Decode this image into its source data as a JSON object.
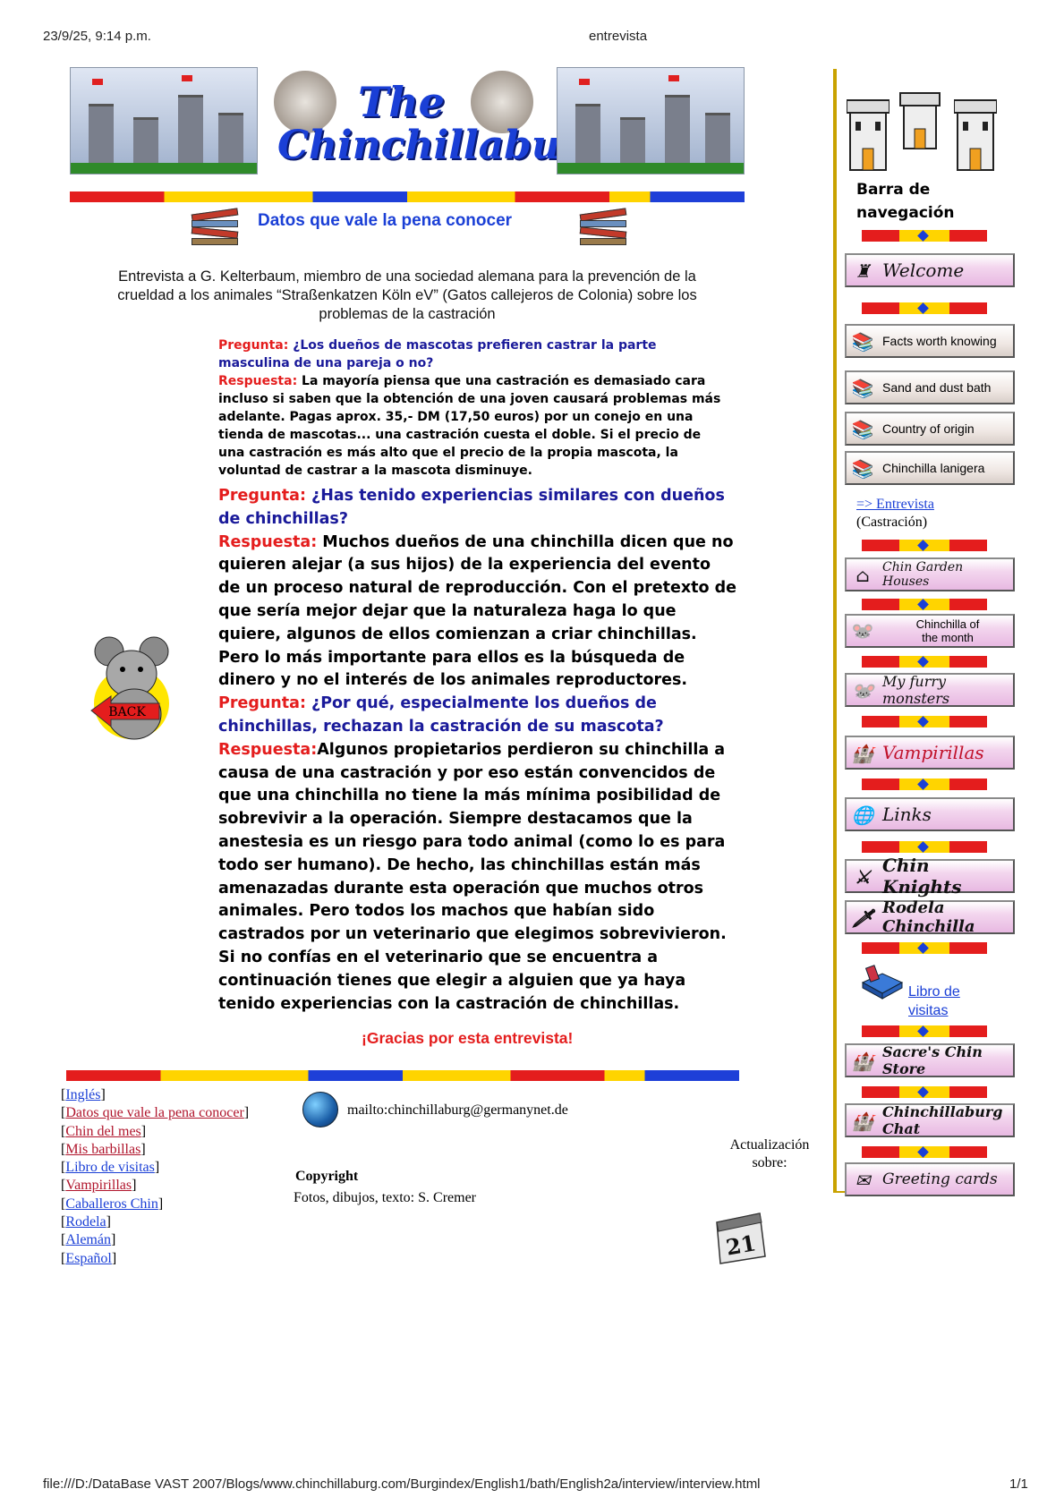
{
  "print_header": {
    "datetime": "23/9/25, 9:14 p.m.",
    "title": "entrevista"
  },
  "print_footer": {
    "url": "file:///D:/DataBase VAST 2007/Blogs/www.chinchillaburg.com/Burgindex/English1/bath/English2a/interview/interview.html",
    "page": "1/1"
  },
  "logo": {
    "the": "The",
    "name": "Chinchillaburg"
  },
  "section_title": "Datos que vale la pena conocer",
  "intro": "Entrevista a G. Kelterbaum, miembro de una sociedad alemana para la prevención de la crueldad a los animales “Straßenkatzen Köln eV” (Gatos callejeros de Colonia) sobre los problemas de la castración",
  "qa": [
    {
      "q_label": "Pregunta:",
      "q": " ¿Los dueños de mascotas prefieren castrar la parte masculina de una pareja o no?",
      "a_label": "Respuesta:",
      "a": " La mayoría piensa que una castración es demasiado cara incluso si saben que la obtención de una joven causará problemas más adelante. Pagas aprox. 35,- DM (17,50 euros) por un conejo en una tienda de mascotas... una castración cuesta el doble. Si el precio de una castración es más alto que el precio de la propia mascota, la voluntad de castrar a la mascota disminuye."
    },
    {
      "q_label": "Pregunta:",
      "q": " ¿Has tenido experiencias similares con dueños de chinchillas?",
      "a_label": "Respuesta:",
      "a": " Muchos dueños de una chinchilla dicen que no quieren alejar (a sus hijos) de la experiencia del evento de un proceso natural de reproducción. Con el pretexto de que sería mejor dejar que la naturaleza haga lo que quiere, algunos de ellos comienzan a criar chinchillas. Pero lo más importante para ellos es la búsqueda de dinero y no el interés de los animales reproductores."
    },
    {
      "q_label": "Pregunta:",
      "q": " ¿Por qué, especialmente los dueños de chinchillas, rechazan la castración de su mascota?",
      "a_label": "Respuesta:",
      "a": "Algunos propietarios perdieron su chinchilla a causa de una castración y por eso están convencidos de que una chinchilla no tiene la más mínima posibilidad de sobrevivir a la operación. Siempre destacamos que la anestesia es un riesgo para todo animal (como lo es para todo ser humano). De hecho, las chinchillas están más amenazadas durante esta operación que muchos otros animales. Pero todos los machos que habían sido castrados por un veterinario que elegimos sobrevivieron. Si no confías en el veterinario que se encuentra a continuación tienes que elegir a alguien que ya haya tenido experiencias con la castración de chinchillas."
    }
  ],
  "thanks": "¡Gracias por esta entrevista!",
  "back_label": "BACK",
  "footer_links": [
    {
      "label": "Inglés",
      "color": "#1a3fd6"
    },
    {
      "label": "Datos que vale la pena conocer",
      "color": "#b0152c"
    },
    {
      "label": "Chin del mes",
      "color": "#b0152c"
    },
    {
      "label": "Mis barbillas",
      "color": "#b0152c"
    },
    {
      "label": "Libro de visitas",
      "color": "#1a3fd6"
    },
    {
      "label": "Vampirillas",
      "color": "#b0152c"
    },
    {
      "label": "Caballeros Chin",
      "color": "#1a3fd6"
    },
    {
      "label": "Rodela",
      "color": "#1a3fd6"
    },
    {
      "label": "Alemán",
      "color": "#1a3fd6"
    },
    {
      "label": "Español",
      "color": "#1a3fd6"
    }
  ],
  "mail": "mailto:chinchillaburg@germanynet.de",
  "copyright": "Copyright",
  "credits": "Fotos, dibujos, texto: S. Cremer",
  "update_label": "Actualización sobre:",
  "calendar_day": "21",
  "sidebar": {
    "title_line1": "Barra de",
    "title_line2": "navegación",
    "welcome": "Welcome",
    "facts": "Facts worth knowing",
    "sand": "Sand and dust bath",
    "origin": "Country of origin",
    "lanigera": "Chinchilla lanigera",
    "interview_link": "=> Entrevista",
    "interview_sub": "(Castración)",
    "garden": "Chin Garden Houses",
    "month1": "Chinchilla of",
    "month2": "the month",
    "furry": "My furry monsters",
    "vamp": "Vampirillas",
    "links": "Links",
    "knights": "Chin Knights",
    "rodela": "Rodela Chinchilla",
    "guest1": "Libro de",
    "guest2": "visitas",
    "store": "Sacre's Chin Store",
    "chat": "Chinchillaburg Chat",
    "cards": "Greeting cards"
  }
}
